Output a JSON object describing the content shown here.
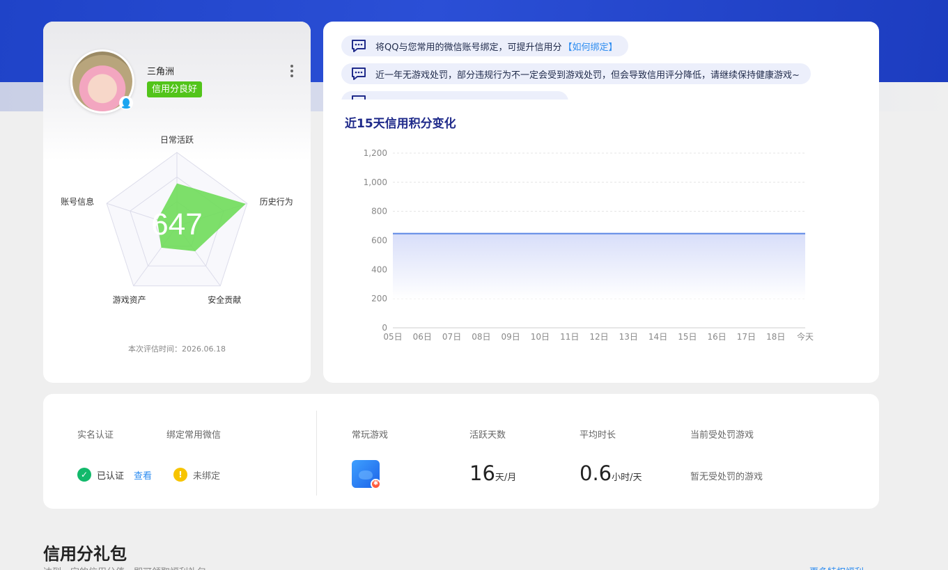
{
  "profile": {
    "username": "三角洲",
    "credit_badge": "信用分良好",
    "score": "647",
    "radar_labels": [
      "日常活跃",
      "历史行为",
      "安全贡献",
      "游戏资产",
      "账号信息"
    ],
    "radar_values": [
      0.58,
      0.98,
      0.42,
      0.36,
      0.28
    ],
    "eval_time": "本次评估时间：2026.06.18"
  },
  "notices": [
    {
      "text": "将QQ与您常用的微信账号绑定，可提升信用分",
      "link": "【如何绑定】"
    },
    {
      "text": "近一年无游戏处罚，部分违规行为不一定会受到游戏处罚，但会导致信用评分降低，请继续保持健康游戏~",
      "link": ""
    },
    {
      "text": "",
      "link": ""
    }
  ],
  "chart_data": {
    "type": "area",
    "title": "近15天信用积分变化",
    "x": [
      "05日",
      "06日",
      "07日",
      "08日",
      "09日",
      "10日",
      "11日",
      "12日",
      "13日",
      "14日",
      "15日",
      "16日",
      "17日",
      "18日",
      "今天"
    ],
    "series": [
      {
        "values": [
          647,
          647,
          647,
          647,
          647,
          647,
          647,
          647,
          647,
          647,
          647,
          647,
          647,
          647,
          647
        ]
      }
    ],
    "ylim": [
      0,
      1200
    ],
    "yticks": [
      "0",
      "200",
      "400",
      "600",
      "800",
      "1,000",
      "1,200"
    ],
    "grid": true,
    "colors": {
      "line": "#5b86e5",
      "fill": "#dfe4fb"
    }
  },
  "stats": {
    "real_name_label": "实名认证",
    "wechat_label": "绑定常用微信",
    "real_name_status": "已认证",
    "view_link": "查看",
    "wechat_status": "未绑定",
    "frequent_game_label": "常玩游戏",
    "active_days_label": "活跃天数",
    "active_days_value": "16",
    "active_days_unit": "天/月",
    "avg_time_label": "平均时长",
    "avg_time_value": "0.6",
    "avg_time_unit": "小时/天",
    "penalty_label": "当前受处罚游戏",
    "penalty_value": "暂无受处罚的游戏"
  },
  "gift": {
    "title": "信用分礼包",
    "subtitle": "达到一定的信用分值，即可领取福利礼包",
    "more_link": "更多特权福利 ›"
  }
}
